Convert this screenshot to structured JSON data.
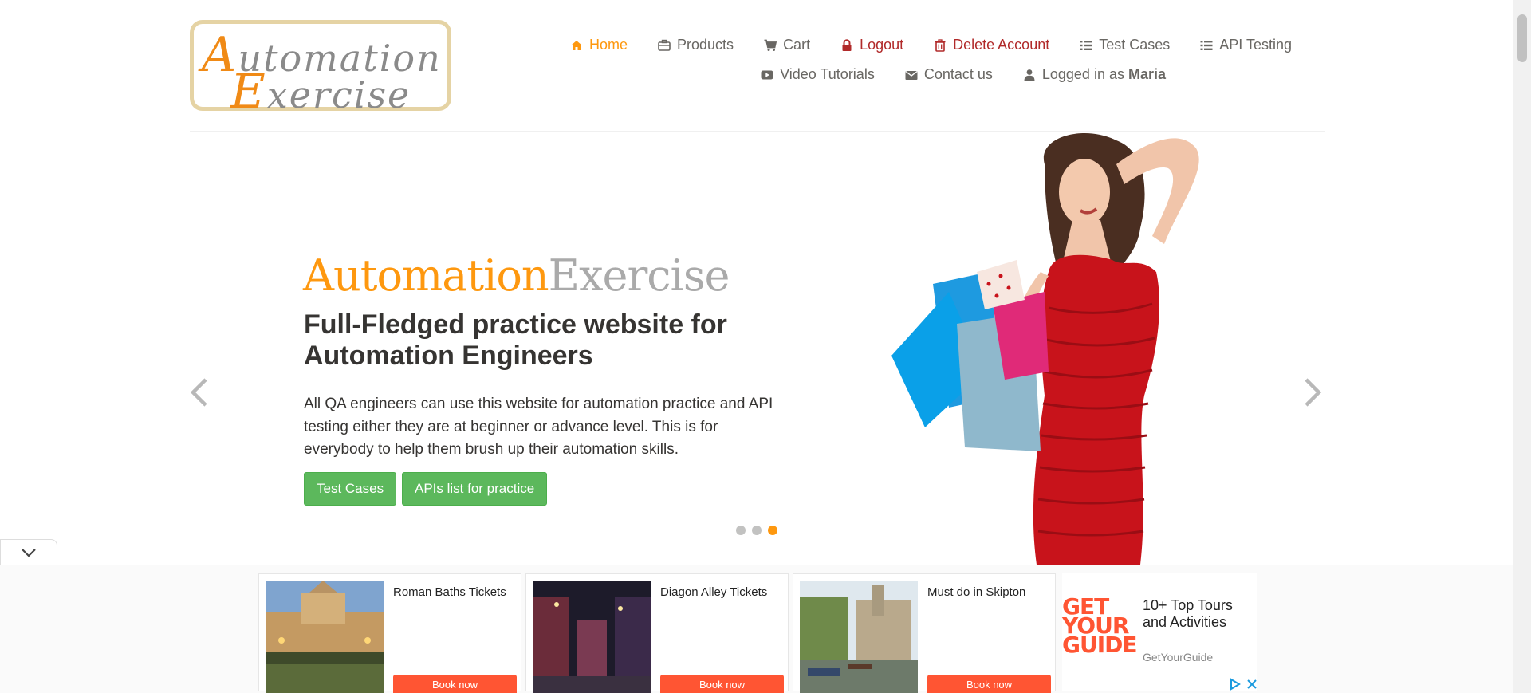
{
  "logo": {
    "line1": "utomation",
    "line1_cap": "A",
    "line2": "xercise",
    "line2_cap": "E"
  },
  "nav": {
    "row1": [
      {
        "label": "Home",
        "icon": "home-icon"
      },
      {
        "label": "Products",
        "icon": "briefcase-icon"
      },
      {
        "label": "Cart",
        "icon": "cart-icon"
      },
      {
        "label": "Logout",
        "icon": "lock-icon"
      },
      {
        "label": "Delete Account",
        "icon": "trash-icon"
      },
      {
        "label": "Test Cases",
        "icon": "list-icon"
      },
      {
        "label": "API Testing",
        "icon": "list-icon"
      }
    ],
    "row2": [
      {
        "label": "Video Tutorials",
        "icon": "youtube-icon"
      },
      {
        "label": "Contact us",
        "icon": "envelope-icon"
      },
      {
        "label": "Logged in as",
        "icon": "user-icon",
        "user": "Maria"
      }
    ]
  },
  "hero": {
    "brand_a": "Automation",
    "brand_b": "Exercise",
    "headline": "Full-Fledged practice website for Automation Engineers",
    "description": "All QA engineers can use this website for automation practice and API testing either they are at beginner or advance level. This is for everybody to help them brush up their automation skills.",
    "btn_test_cases": "Test Cases",
    "btn_apis": "APIs list for practice",
    "active_slide": 3,
    "slide_count": 3
  },
  "ads": [
    {
      "title": "Roman Baths Tickets",
      "cta": "Book now"
    },
    {
      "title": "Diagon Alley Tickets",
      "cta": "Book now"
    },
    {
      "title": "Must do in Skipton",
      "cta": "Book now"
    }
  ],
  "gyg": {
    "logo_line1": "GET",
    "logo_line2": "YOUR",
    "logo_line3": "GUIDE",
    "title": "10+ Top Tours and Activities",
    "sub": "GetYourGuide"
  },
  "colors": {
    "accent": "#fe980f",
    "danger": "#b12a2a",
    "button_green": "#5cb85c",
    "ad_cta": "#ff5533"
  }
}
